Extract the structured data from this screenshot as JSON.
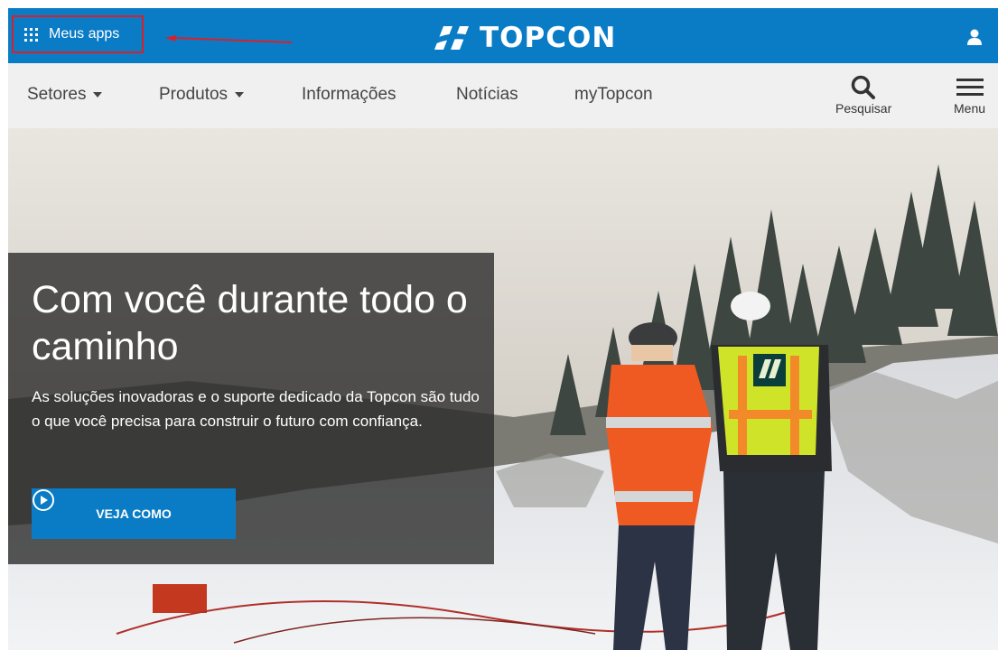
{
  "topbar": {
    "my_apps_label": "Meus apps",
    "brand": "TOPCON",
    "colors": {
      "brand_blue": "#0a7cc6",
      "highlight_red": "#d9202a"
    },
    "icons": [
      "grid-icon",
      "topcon-logo-icon",
      "user-icon"
    ]
  },
  "nav": {
    "items": [
      {
        "label": "Setores",
        "has_dropdown": true
      },
      {
        "label": "Produtos",
        "has_dropdown": true
      },
      {
        "label": "Informações",
        "has_dropdown": false
      },
      {
        "label": "Notícias",
        "has_dropdown": false
      },
      {
        "label": "myTopcon",
        "has_dropdown": false
      }
    ],
    "search_label": "Pesquisar",
    "menu_label": "Menu"
  },
  "hero": {
    "headline": "Com você durante todo o caminho",
    "subtext": "As soluções inovadoras e o suporte dedicado da Topcon são tudo o que você precisa para construir o futuro com confiança.",
    "cta_label": "VEJA COMO",
    "vest_brand": "TOPCON"
  }
}
